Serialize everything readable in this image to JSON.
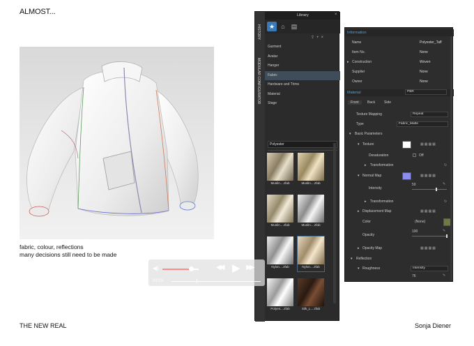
{
  "slide": {
    "title": "ALMOST...",
    "caption_lines": [
      "fabric, colour, reflections",
      "many decisions still need to be made"
    ],
    "footer_left": "THE NEW REAL",
    "footer_right": "Sonja Diener"
  },
  "library": {
    "header": "Library",
    "vertical_tabs": [
      "HISTORY",
      "MODULAR CONFIGURATOR"
    ],
    "items": [
      "Garment",
      "Avatar",
      "Hanger",
      "Fabric",
      "Hardware and Trims",
      "Material",
      "Stage"
    ],
    "selected_item": "Fabric",
    "search_value": "Polyester",
    "thumbs": [
      {
        "label": "Muslin....zfab"
      },
      {
        "label": "Muslin....zfab"
      },
      {
        "label": "Muslin....zfab"
      },
      {
        "label": "Muslin....zfab"
      },
      {
        "label": "Nylon....zfab"
      },
      {
        "label": "Nylon....zfab"
      },
      {
        "label": "Polyes....zfab"
      },
      {
        "label": "Silk_L....zfab"
      }
    ]
  },
  "properties": {
    "information_header": "Information",
    "info_rows": [
      {
        "label": "Name",
        "value": "Polyester_Taff"
      },
      {
        "label": "Item No.",
        "value": "None"
      },
      {
        "label": "Construction",
        "value": "Woven"
      },
      {
        "label": "Supplier",
        "value": "None"
      },
      {
        "label": "Owner",
        "value": "None"
      }
    ],
    "material_header": "Material",
    "material_type": "PBR",
    "side_tabs": [
      "Front",
      "Back",
      "Side"
    ],
    "texture_mapping_label": "Texture Mapping",
    "texture_mapping_value": "Repeat",
    "type_label": "Type",
    "type_value": "Fabric_Matte",
    "basic_params": "Basic Parameters",
    "texture_label": "Texture",
    "desaturation_label": "Desaturation",
    "desaturation_value": "Off",
    "transformation_label": "Transformation",
    "normal_map_label": "Normal Map",
    "intensity_label": "Intensity",
    "intensity_value": "50",
    "displacement_label": "Displacement Map",
    "color_label": "Color",
    "color_value": "(None)",
    "opacity_label": "Opacity",
    "opacity_value": "100",
    "opacity_map_label": "Opacity Map",
    "reflection_label": "Reflection",
    "roughness_label": "Roughness",
    "roughness_type": "Intensity",
    "roughness_value": "76"
  },
  "player": {
    "time": "01:03",
    "volume_fraction": 0.78,
    "progress_fraction": 0.28
  },
  "colors": {
    "accent_blue": "#4aa3e0",
    "selected_row": "#3f4d5a",
    "normal_map_swatch": "#8a8cf0",
    "color_swatch": "#6f7a3e"
  },
  "icons": {
    "play": "play-icon",
    "rewind": "rewind-icon",
    "forward": "fast-forward-icon",
    "volume": "volume-icon"
  }
}
